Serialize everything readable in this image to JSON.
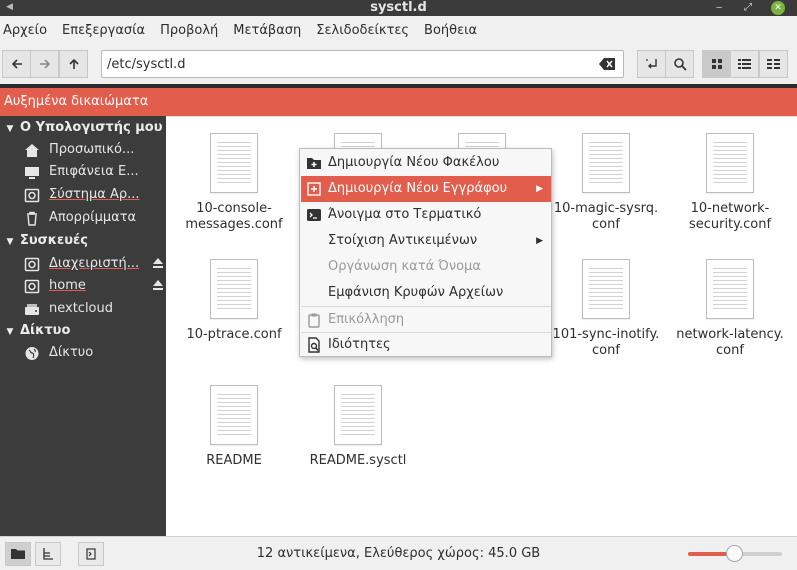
{
  "window": {
    "title": "sysctl.d"
  },
  "menubar": [
    "Αρχείο",
    "Επεξεργασία",
    "Προβολή",
    "Μετάβαση",
    "Σελιδοδείκτες",
    "Βοήθεια"
  ],
  "location": {
    "path": "/etc/sysctl.d"
  },
  "banner": {
    "text": "Αυξημένα δικαιώματα"
  },
  "sidebar": {
    "sections": [
      {
        "label": "Ο Υπολογιστής μου",
        "items": [
          {
            "label": "Προσωπικό...",
            "icon": "home-icon"
          },
          {
            "label": "Επιφάνεια Ε...",
            "icon": "desktop-icon"
          },
          {
            "label": "Σύστημα Αρ...",
            "icon": "drive-icon"
          },
          {
            "label": "Απορρίμματα",
            "icon": "trash-icon"
          }
        ]
      },
      {
        "label": "Συσκευές",
        "items": [
          {
            "label": "Διαχειριστή...",
            "icon": "drive-icon"
          },
          {
            "label": "home",
            "icon": "drive-icon"
          },
          {
            "label": "nextcloud",
            "icon": "removable-drive-icon"
          }
        ]
      },
      {
        "label": "Δίκτυο",
        "items": [
          {
            "label": "Δίκτυο",
            "icon": "network-icon"
          }
        ]
      }
    ]
  },
  "files": [
    "10-console-\nmessages.conf",
    "10-magic-sysrq.\nconf",
    "10-network-\nsecurity.conf",
    "10-ptrace.conf",
    "101-sync-inotify.\nconf",
    "network-latency.\nconf",
    "README",
    "README.sysctl"
  ],
  "context_menu": [
    {
      "label": "Δημιουργία Νέου Φακέλου",
      "icon": "new-folder-icon"
    },
    {
      "label": "Δημιουργία Νέου Εγγράφου",
      "icon": "new-document-icon",
      "submenu": true,
      "highlighted": true
    },
    {
      "label": "Άνοιγμα στο Τερματικό",
      "icon": "terminal-icon"
    },
    {
      "label": "Στοίχιση Αντικειμένων",
      "submenu": true
    },
    {
      "label": "Οργάνωση κατά Όνομα",
      "disabled": true
    },
    {
      "label": "Εμφάνιση Κρυφών Αρχείων"
    },
    {
      "label": "Επικόλληση",
      "icon": "paste-icon",
      "disabled": true
    },
    {
      "label": "Ιδιότητες",
      "icon": "properties-icon"
    }
  ],
  "status": {
    "text": "12 αντικείμενα, Ελεύθερος χώρος: 45.0 GB",
    "zoom_level": 0.5
  },
  "colors": {
    "accent": "#e35d4d",
    "sidebar_bg": "#3c3c3c",
    "close_button": "#7ab33f"
  }
}
